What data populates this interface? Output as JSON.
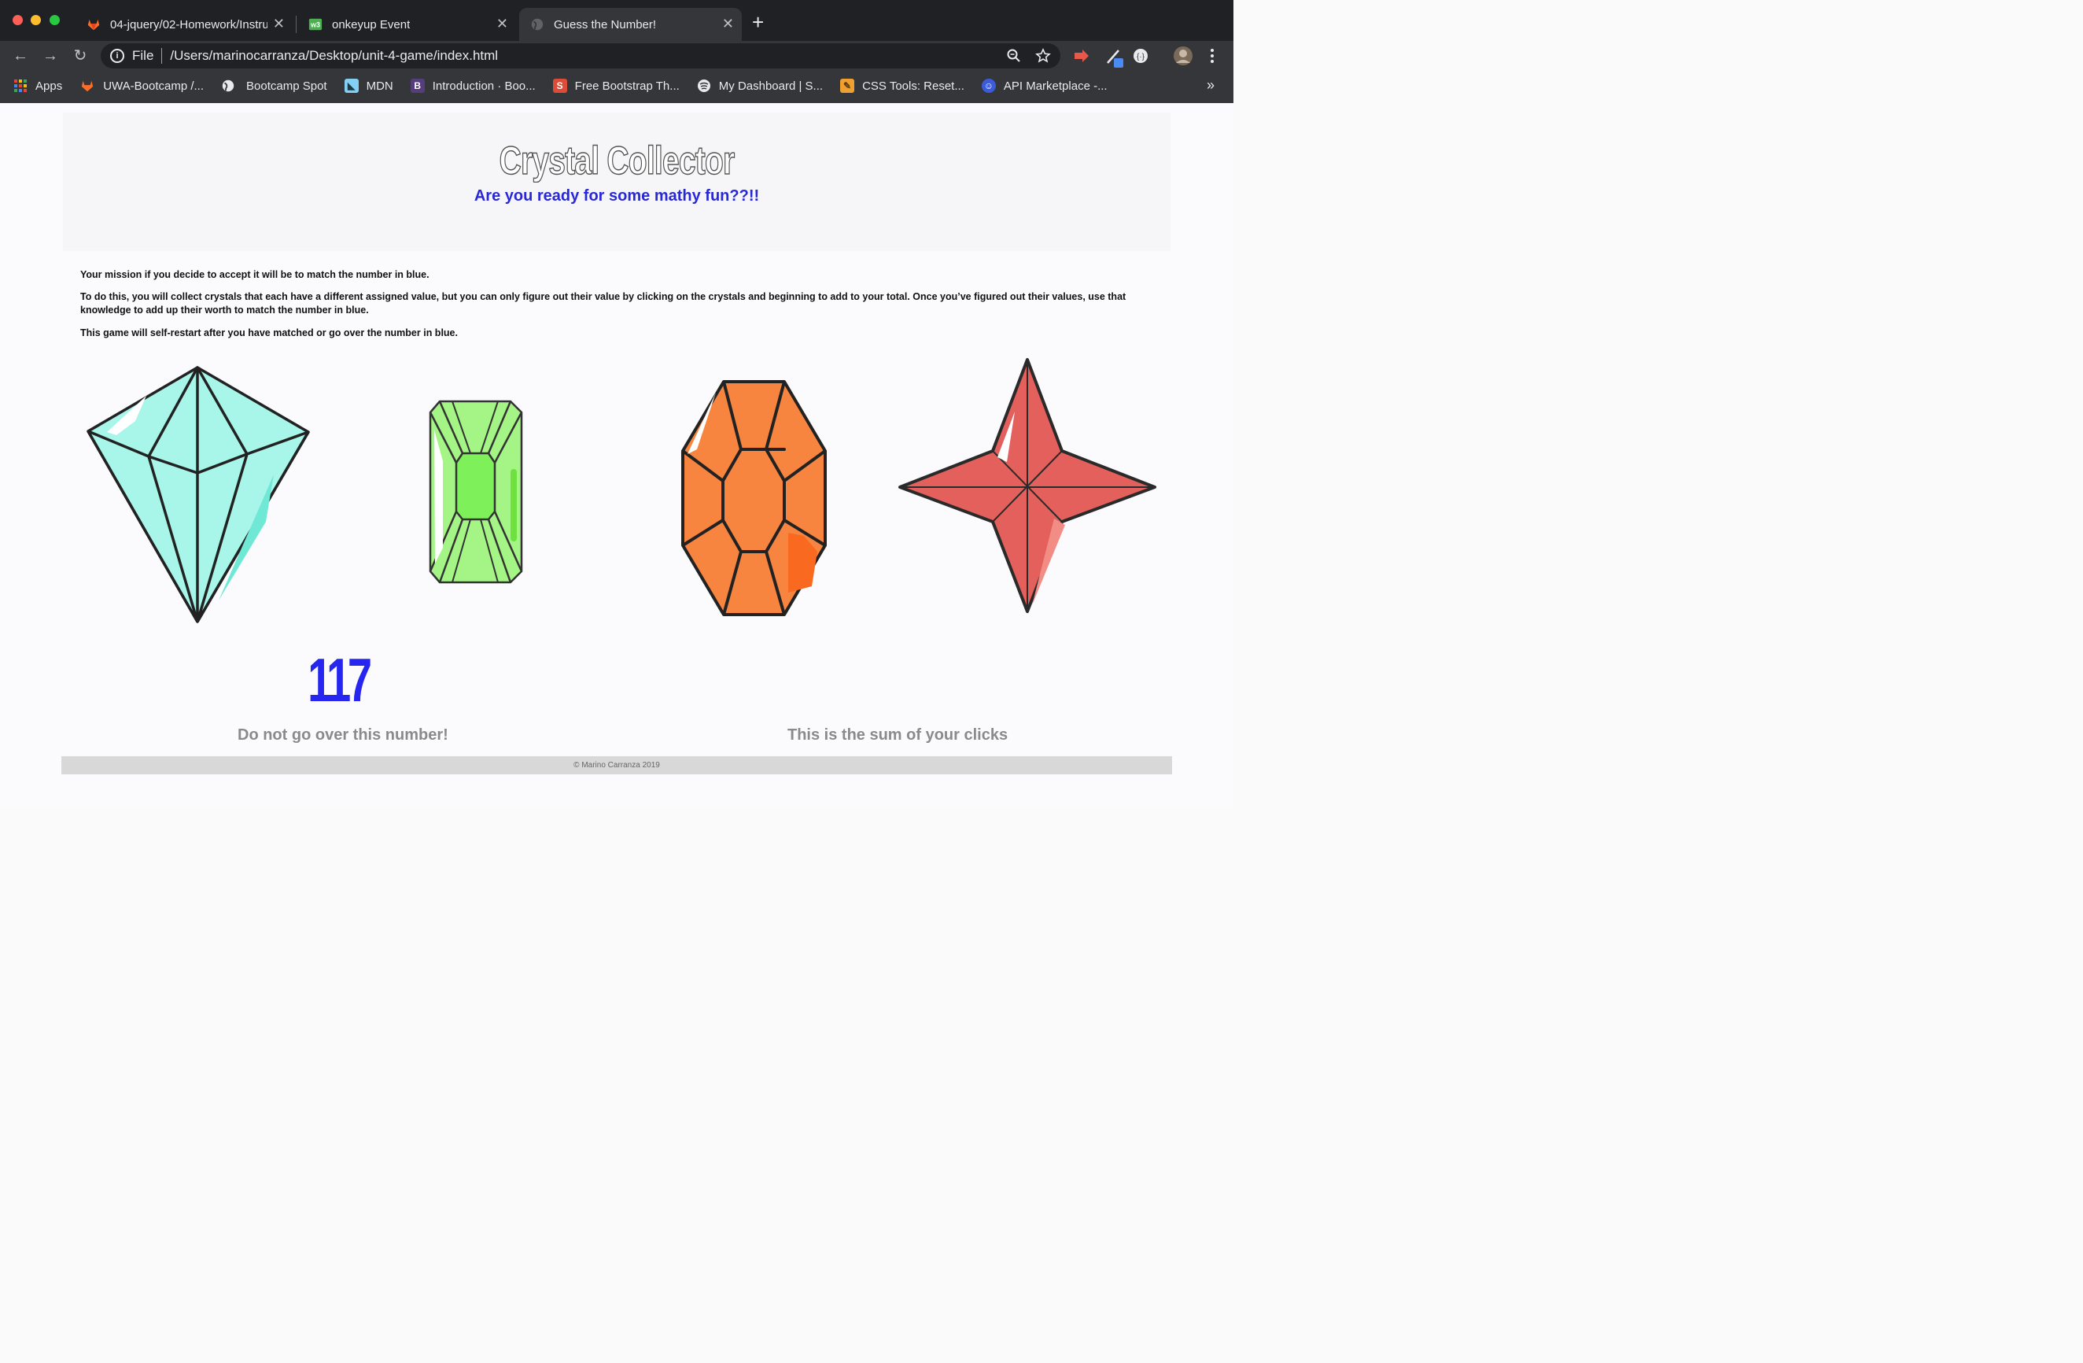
{
  "browser": {
    "tabs": [
      {
        "title": "04-jquery/02-Homework/Instru",
        "icon": "gitlab-icon"
      },
      {
        "title": "onkeyup Event",
        "icon": "w3schools-icon"
      },
      {
        "title": "Guess the Number!",
        "icon": "globe-icon"
      }
    ],
    "address": {
      "scheme_label": "File",
      "url": "/Users/marinocarranza/Desktop/unit-4-game/index.html"
    },
    "bookmarks": [
      {
        "label": "Apps",
        "icon": "apps-grid-icon",
        "color": "#ea4335"
      },
      {
        "label": "UWA-Bootcamp /...",
        "icon": "gitlab-icon",
        "color": "#fc6d26"
      },
      {
        "label": "Bootcamp Spot",
        "icon": "globe-icon",
        "color": "#ffffff"
      },
      {
        "label": "MDN",
        "icon": "mdn-icon",
        "color": "#83d0f2"
      },
      {
        "label": "Introduction · Boo...",
        "icon": "bootstrap-icon",
        "color": "#563d7c"
      },
      {
        "label": "Free Bootstrap Th...",
        "icon": "startbootstrap-icon",
        "color": "#dd4b39"
      },
      {
        "label": "My Dashboard | S...",
        "icon": "dashboard-icon",
        "color": "#dddddd"
      },
      {
        "label": "CSS Tools: Reset...",
        "icon": "css-tools-icon",
        "color": "#f0a030"
      },
      {
        "label": "API Marketplace -...",
        "icon": "rapidapi-icon",
        "color": "#3b5bdb"
      }
    ],
    "overflow_label": "»"
  },
  "game": {
    "title": "Crystal Collector",
    "subtitle": "Are you ready for some mathy fun??!!",
    "instructions": [
      "Your mission if you decide to accept it will be to match the number in blue.",
      "To do this, you will collect crystals that each have a different assigned value, but you can only figure out their value by clicking on the crystals and beginning to add to your total. Once you’ve figured out their values, use that knowledge to add up their worth to match the number in blue.",
      "This game will self-restart after you have matched or go over the number in blue."
    ],
    "target_number": "117",
    "target_caption": "Do not go over this number!",
    "sum_caption": "This is the sum of your clicks",
    "footer": "© Marino Carranza 2019",
    "colors": {
      "target": "#2626f0",
      "subtitle": "#2828d8",
      "cyan": "#a8f5ea",
      "green": "#a4f486",
      "orange": "#f7843f",
      "red": "#e4605c"
    }
  }
}
